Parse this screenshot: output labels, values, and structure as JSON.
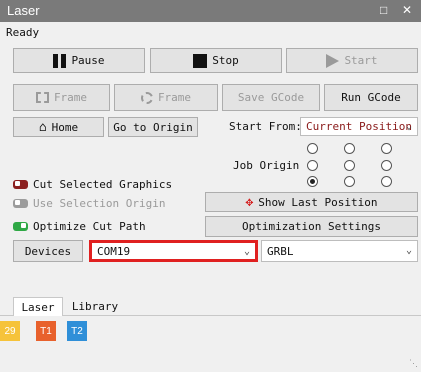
{
  "window": {
    "title": "Laser",
    "status": "Ready"
  },
  "controls": {
    "pause": "Pause",
    "stop": "Stop",
    "start": "Start"
  },
  "row2": {
    "frame1": "Frame",
    "frame2": "Frame",
    "save_gcode": "Save GCode",
    "run_gcode": "Run GCode"
  },
  "row3": {
    "home": "Home",
    "go_to_origin": "Go to Origin",
    "start_from_label": "Start From:",
    "start_from_value": "Current Position"
  },
  "job_origin": {
    "label": "Job Origin",
    "selected_index": 6
  },
  "options": {
    "cut_selected": "Cut Selected Graphics",
    "use_selection_origin": "Use Selection Origin",
    "optimize_cut_path": "Optimize Cut Path",
    "show_last_position": "Show Last Position",
    "optimization_settings": "Optimization Settings"
  },
  "devices": {
    "button": "Devices",
    "port": "COM19",
    "controller": "GRBL"
  },
  "tabs": [
    {
      "label": "Laser"
    },
    {
      "label": "Library"
    }
  ],
  "layers": [
    {
      "label": "29",
      "color": "#f6c33a"
    },
    {
      "label": "T1",
      "color": "#e8612c"
    },
    {
      "label": "T2",
      "color": "#2f8fd8"
    }
  ],
  "colors": {
    "highlight": "#e02020",
    "titlebar": "#7a7a7a"
  }
}
